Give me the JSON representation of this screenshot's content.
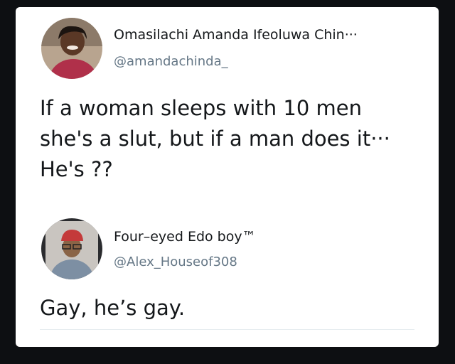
{
  "tweet1": {
    "author_name": "Omasilachi Amanda Ifeoluwa Chin···",
    "handle": "@amandachinda_",
    "lines": [
      "If a woman sleeps with 10 men",
      "she's a slut, but if a man does it···",
      "He's ??"
    ]
  },
  "tweet2": {
    "author_name": "Four–eyed Edo boy™",
    "handle": "@Alex_Houseof308",
    "text": "Gay, he’s gay."
  }
}
